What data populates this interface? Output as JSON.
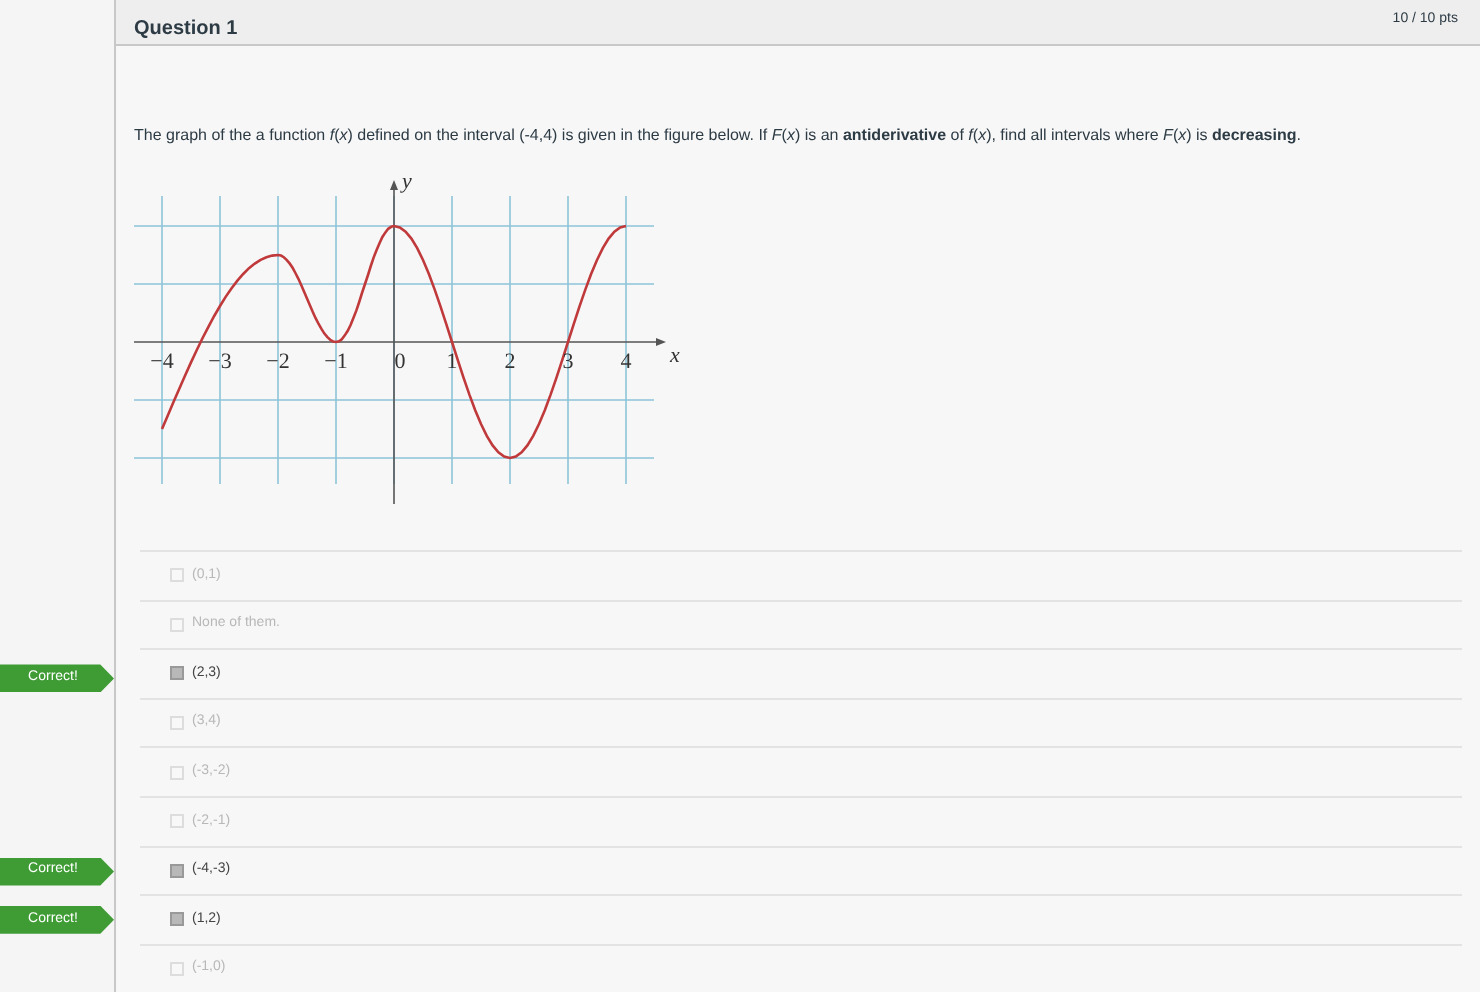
{
  "question": {
    "title": "Question 1",
    "score": "10 / 10 pts",
    "text": "The graph of the a function *f*(*x*) defined on the interval (-4,4) is given in the figure below. If *F*(*x*) is an **antiderivative** of *f*(*x*), find all intervals where *F*(*x*) is **decreasing**."
  },
  "graph": {
    "x_tick_labels": [
      "−4",
      "−3",
      "−2",
      "−1",
      "0",
      "1",
      "2",
      "3",
      "4"
    ],
    "x_axis_label": "x",
    "y_axis_label": "y"
  },
  "answers": [
    {
      "label": "(0,1)",
      "checked": false
    },
    {
      "label": "None of them.",
      "checked": false
    },
    {
      "label": "(2,3)",
      "checked": true,
      "badge": "Correct!"
    },
    {
      "label": "(3,4)",
      "checked": false
    },
    {
      "label": "(-3,-2)",
      "checked": false
    },
    {
      "label": "(-2,-1)",
      "checked": false
    },
    {
      "label": "(-4,-3)",
      "checked": true,
      "badge": "Correct!"
    },
    {
      "label": "(1,2)",
      "checked": true,
      "badge": "Correct!"
    },
    {
      "label": "(-1,0)",
      "checked": false
    }
  ]
}
